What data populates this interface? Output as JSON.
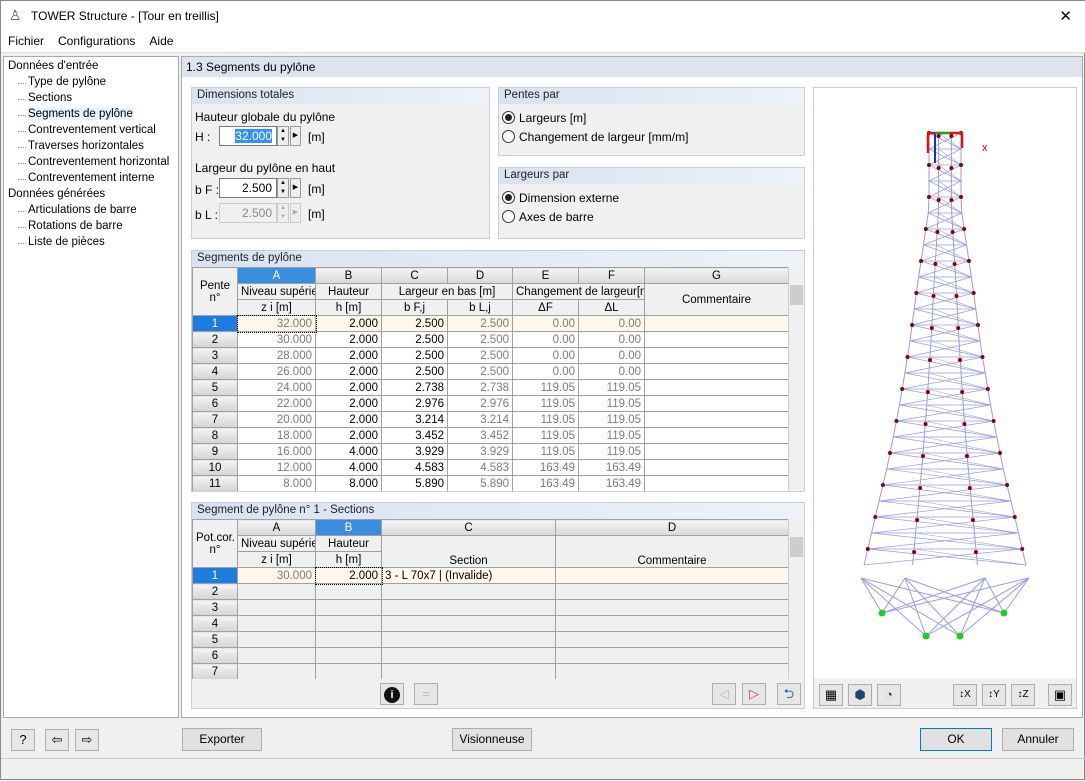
{
  "window": {
    "title": "TOWER Structure - [Tour en treillis]",
    "close": "✕"
  },
  "menu": [
    "Fichier",
    "Configurations",
    "Aide"
  ],
  "tree": [
    {
      "label": "Données d'entrée",
      "level": 0
    },
    {
      "label": "Type de pylône",
      "level": 1
    },
    {
      "label": "Sections",
      "level": 1
    },
    {
      "label": "Segments de pylône",
      "level": 1,
      "selected": true
    },
    {
      "label": "Contreventement vertical",
      "level": 1
    },
    {
      "label": "Traverses horizontales",
      "level": 1
    },
    {
      "label": "Contreventement horizontal",
      "level": 1
    },
    {
      "label": "Contreventement interne",
      "level": 1
    },
    {
      "label": "Données générées",
      "level": 0
    },
    {
      "label": "Articulations de barre",
      "level": 1
    },
    {
      "label": "Rotations de barre",
      "level": 1
    },
    {
      "label": "Liste de pièces",
      "level": 1
    }
  ],
  "page_title": "1.3 Segments du pylône",
  "dimensions": {
    "title": "Dimensions totales",
    "height_label": "Hauteur globale du pylône",
    "h_sym": "H :",
    "h_value": "32.000",
    "h_unit": "[m]",
    "width_label": "Largeur du pylône en haut",
    "bf_sym": "b F :",
    "bf_value": "2.500",
    "bf_unit": "[m]",
    "bl_sym": "b L :",
    "bl_value": "2.500",
    "bl_unit": "[m]"
  },
  "pentes": {
    "title": "Pentes par",
    "options": [
      "Largeurs [m]",
      "Changement de largeur [mm/m]"
    ],
    "selected": 0
  },
  "largeurs": {
    "title": "Largeurs par",
    "options": [
      "Dimension externe",
      "Axes de barre"
    ],
    "selected": 0
  },
  "segments": {
    "title": "Segments de pylône",
    "col_letters": [
      "A",
      "B",
      "C",
      "D",
      "E",
      "F",
      "G"
    ],
    "rowhdr": "Pente n°",
    "h1": [
      "Niveau supérieu",
      "Hauteur",
      "Largeur en bas [m]",
      "Changement de largeur[mm/"
    ],
    "h2": [
      "z i [m]",
      "h [m]",
      "b F,j",
      "b L,j",
      "ΔF",
      "ΔL",
      "Commentaire"
    ],
    "rows": [
      [
        "1",
        "32.000",
        "2.000",
        "2.500",
        "2.500",
        "0.00",
        "0.00",
        ""
      ],
      [
        "2",
        "30.000",
        "2.000",
        "2.500",
        "2.500",
        "0.00",
        "0.00",
        ""
      ],
      [
        "3",
        "28.000",
        "2.000",
        "2.500",
        "2.500",
        "0.00",
        "0.00",
        ""
      ],
      [
        "4",
        "26.000",
        "2.000",
        "2.500",
        "2.500",
        "0.00",
        "0.00",
        ""
      ],
      [
        "5",
        "24.000",
        "2.000",
        "2.738",
        "2.738",
        "119.05",
        "119.05",
        ""
      ],
      [
        "6",
        "22.000",
        "2.000",
        "2.976",
        "2.976",
        "119.05",
        "119.05",
        ""
      ],
      [
        "7",
        "20.000",
        "2.000",
        "3.214",
        "3.214",
        "119.05",
        "119.05",
        ""
      ],
      [
        "8",
        "18.000",
        "2.000",
        "3.452",
        "3.452",
        "119.05",
        "119.05",
        ""
      ],
      [
        "9",
        "16.000",
        "4.000",
        "3.929",
        "3.929",
        "119.05",
        "119.05",
        ""
      ],
      [
        "10",
        "12.000",
        "4.000",
        "4.583",
        "4.583",
        "163.49",
        "163.49",
        ""
      ],
      [
        "11",
        "8.000",
        "8.000",
        "5.890",
        "5.890",
        "163.49",
        "163.49",
        ""
      ]
    ]
  },
  "sections": {
    "title": "Segment de pylône n° 1  -  Sections",
    "col_letters": [
      "A",
      "B",
      "C",
      "D"
    ],
    "rowhdr": "Pot.cor. n°",
    "h1": [
      "Niveau supérieu",
      "Hauteur",
      "",
      ""
    ],
    "h2": [
      "z i [m]",
      "h [m]",
      "Section",
      "Commentaire"
    ],
    "rows": [
      [
        "1",
        "30.000",
        "2.000",
        "3 - L 70x7 | (Invalide)",
        ""
      ],
      [
        "2",
        "",
        "",
        "",
        ""
      ],
      [
        "3",
        "",
        "",
        "",
        ""
      ],
      [
        "4",
        "",
        "",
        "",
        ""
      ],
      [
        "5",
        "",
        "",
        "",
        ""
      ],
      [
        "6",
        "",
        "",
        "",
        ""
      ],
      [
        "7",
        "",
        "",
        "",
        ""
      ]
    ]
  },
  "buttons": {
    "export": "Exporter",
    "viewer": "Visionneuse",
    "ok": "OK",
    "cancel": "Annuler"
  },
  "viewer": {
    "axis_x": "x"
  },
  "colors": {
    "accent": "#1e7be0",
    "tower": "#9a9ae8",
    "node": "#8b0000",
    "support": "#22cc22"
  }
}
